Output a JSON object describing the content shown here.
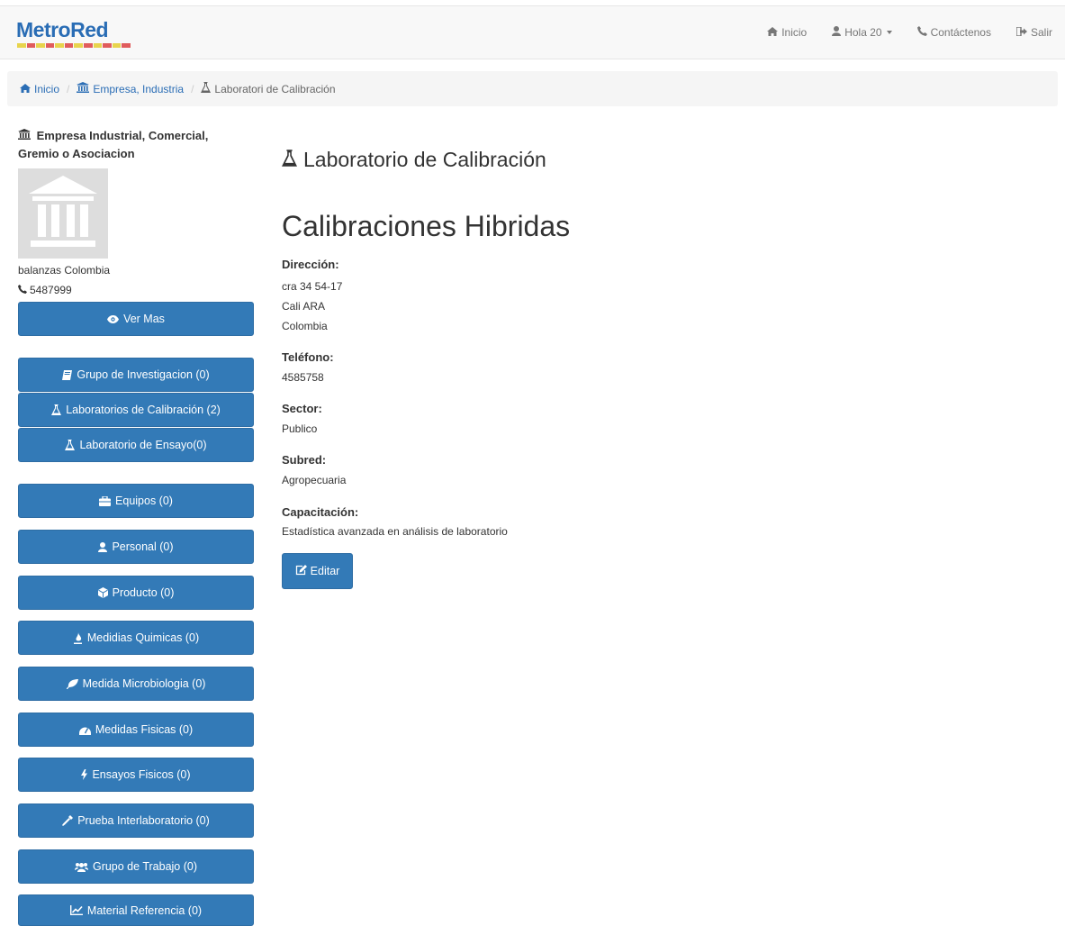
{
  "brand": {
    "name": "MetroRed"
  },
  "colors": {
    "primary": "#337ab7",
    "link": "#2a6db5",
    "navbar_bg": "#f8f8f8",
    "breadcrumb_bg": "#f5f5f5"
  },
  "navbar": {
    "items": [
      {
        "label": "Inicio",
        "icon": "home-icon"
      },
      {
        "label": "Hola 20",
        "icon": "user-icon"
      },
      {
        "label": "Contáctenos",
        "icon": "phone-icon"
      },
      {
        "label": "Salir",
        "icon": "sign-out-icon"
      }
    ]
  },
  "breadcrumb": [
    {
      "label": "Inicio",
      "icon": "home-icon"
    },
    {
      "label": "Empresa, Industria",
      "icon": "institution-icon"
    },
    {
      "label": "Laboratori de Calibración",
      "icon": "flask-icon"
    }
  ],
  "sidebar": {
    "company_type": "Empresa Industrial, Comercial, Gremio o Asociacion",
    "company_type_line1": "Empresa Industrial, Comercial,",
    "company_type_line2": "Gremio o Asociacion",
    "company_name": "balanzas Colombia",
    "company_phone": "5487999",
    "ver_mas": "Ver Mas",
    "buttons": [
      {
        "label": "Grupo de Investigacion (0)",
        "icon": "book-icon"
      },
      {
        "label": "Laboratorios de Calibración (2)",
        "icon": "flask-icon"
      },
      {
        "label": "Laboratorio de Ensayo(0)",
        "icon": "flask-icon"
      },
      {
        "label": "Equipos (0)",
        "icon": "briefcase-icon"
      },
      {
        "label": "Personal (0)",
        "icon": "user-icon"
      },
      {
        "label": "Producto (0)",
        "icon": "cube-icon"
      },
      {
        "label": "Medidias Quimicas (0)",
        "icon": "tint-icon"
      },
      {
        "label": "Medida Microbiologia (0)",
        "icon": "leaf-icon"
      },
      {
        "label": "Medidas Fisicas (0)",
        "icon": "tachometer-icon"
      },
      {
        "label": "Ensayos Fisicos (0)",
        "icon": "bolt-icon"
      },
      {
        "label": "Prueba Interlaboratorio (0)",
        "icon": "eyedropper-icon"
      },
      {
        "label": "Grupo de Trabajo (0)",
        "icon": "users-icon"
      },
      {
        "label": "Material Referencia (0)",
        "icon": "line-chart-icon"
      }
    ]
  },
  "main": {
    "section_title": "Laboratorio de Calibración",
    "lab_name": "Calibraciones Hibridas",
    "fields": {
      "direccion_label": "Dirección:",
      "direccion_line1": "cra 34 54-17",
      "direccion_line2": "Cali ARA",
      "direccion_line3": "Colombia",
      "telefono_label": "Teléfono:",
      "telefono_value": "4585758",
      "sector_label": "Sector:",
      "sector_value": "Publico",
      "subred_label": "Subred:",
      "subred_value": "Agropecuaria",
      "capacitacion_label": "Capacitación:",
      "capacitacion_value": "Estadística avanzada en análisis de laboratorio"
    },
    "edit_button": "Editar"
  }
}
